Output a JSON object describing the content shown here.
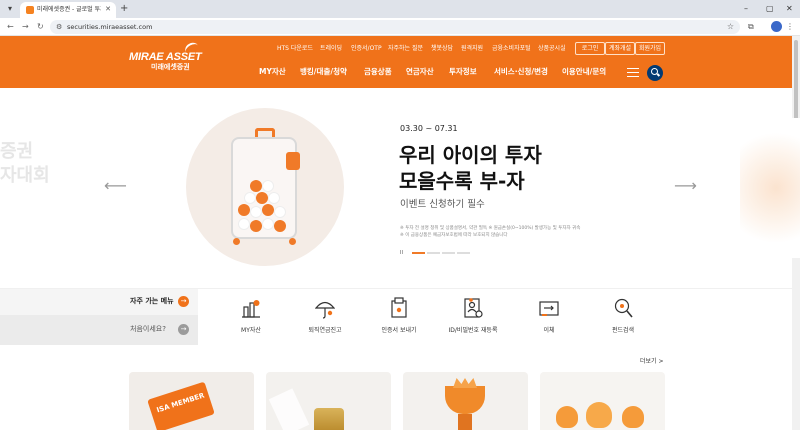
{
  "browser": {
    "tab_title": "미래에셋증권 - 글로벌 투자 파트너",
    "url": "securities.miraeasset.com",
    "tab_close": "✕",
    "new_tab": "+",
    "min": "–",
    "max": "▢",
    "close": "✕"
  },
  "header": {
    "logo_en": "MIRAE ASSET",
    "logo_ko": "미래에셋증권",
    "utility_links": [
      "HTS 다운로드",
      "트레이딩",
      "인증서/OTP",
      "자주하는 질문",
      "챗봇상담",
      "원격지원",
      "금융소비자포털",
      "상품공시실"
    ],
    "login": "로그인",
    "open_account": "계좌개설",
    "join": "회원가입",
    "gnb": [
      "MY자산",
      "뱅킹/대출/청약",
      "금융상품",
      "연금자산",
      "투자정보",
      "서비스·신청/변경",
      "이용안내/문의"
    ]
  },
  "hero": {
    "ghost_text": "증권\n자대회",
    "date": "03.30 ~ 07.31",
    "headline_1": "우리 아이의 투자",
    "headline_2": "모을수록 부-자",
    "sub": "이벤트 신청하기 필수",
    "note_1": "※ 투자 전 설명 청취 및 상품설명서, 약관 필독 ※ 원금손실(0~100%) 발생가능 및 투자자 귀속",
    "note_2": "※ 이 금융상품은 예금자보호법에 따라 보호되지 않습니다",
    "pause": "II"
  },
  "quick": {
    "title": "자주 가는 메뉴",
    "first_visit": "처음이세요?",
    "items": [
      {
        "label": "MY자산",
        "icon": "chart-icon"
      },
      {
        "label": "퇴직연금진고",
        "icon": "umbrella-icon"
      },
      {
        "label": "인증서 보내기",
        "icon": "certificate-icon"
      },
      {
        "label": "ID/비밀번호 재등록",
        "icon": "id-card-icon"
      },
      {
        "label": "이체",
        "icon": "transfer-icon"
      },
      {
        "label": "펀드검색",
        "icon": "search-icon"
      }
    ]
  },
  "cards": {
    "more": "더보기 >",
    "card1_text": "ISA MEMBER"
  },
  "colors": {
    "brand_orange": "#f0721a",
    "navy": "#033a73"
  }
}
